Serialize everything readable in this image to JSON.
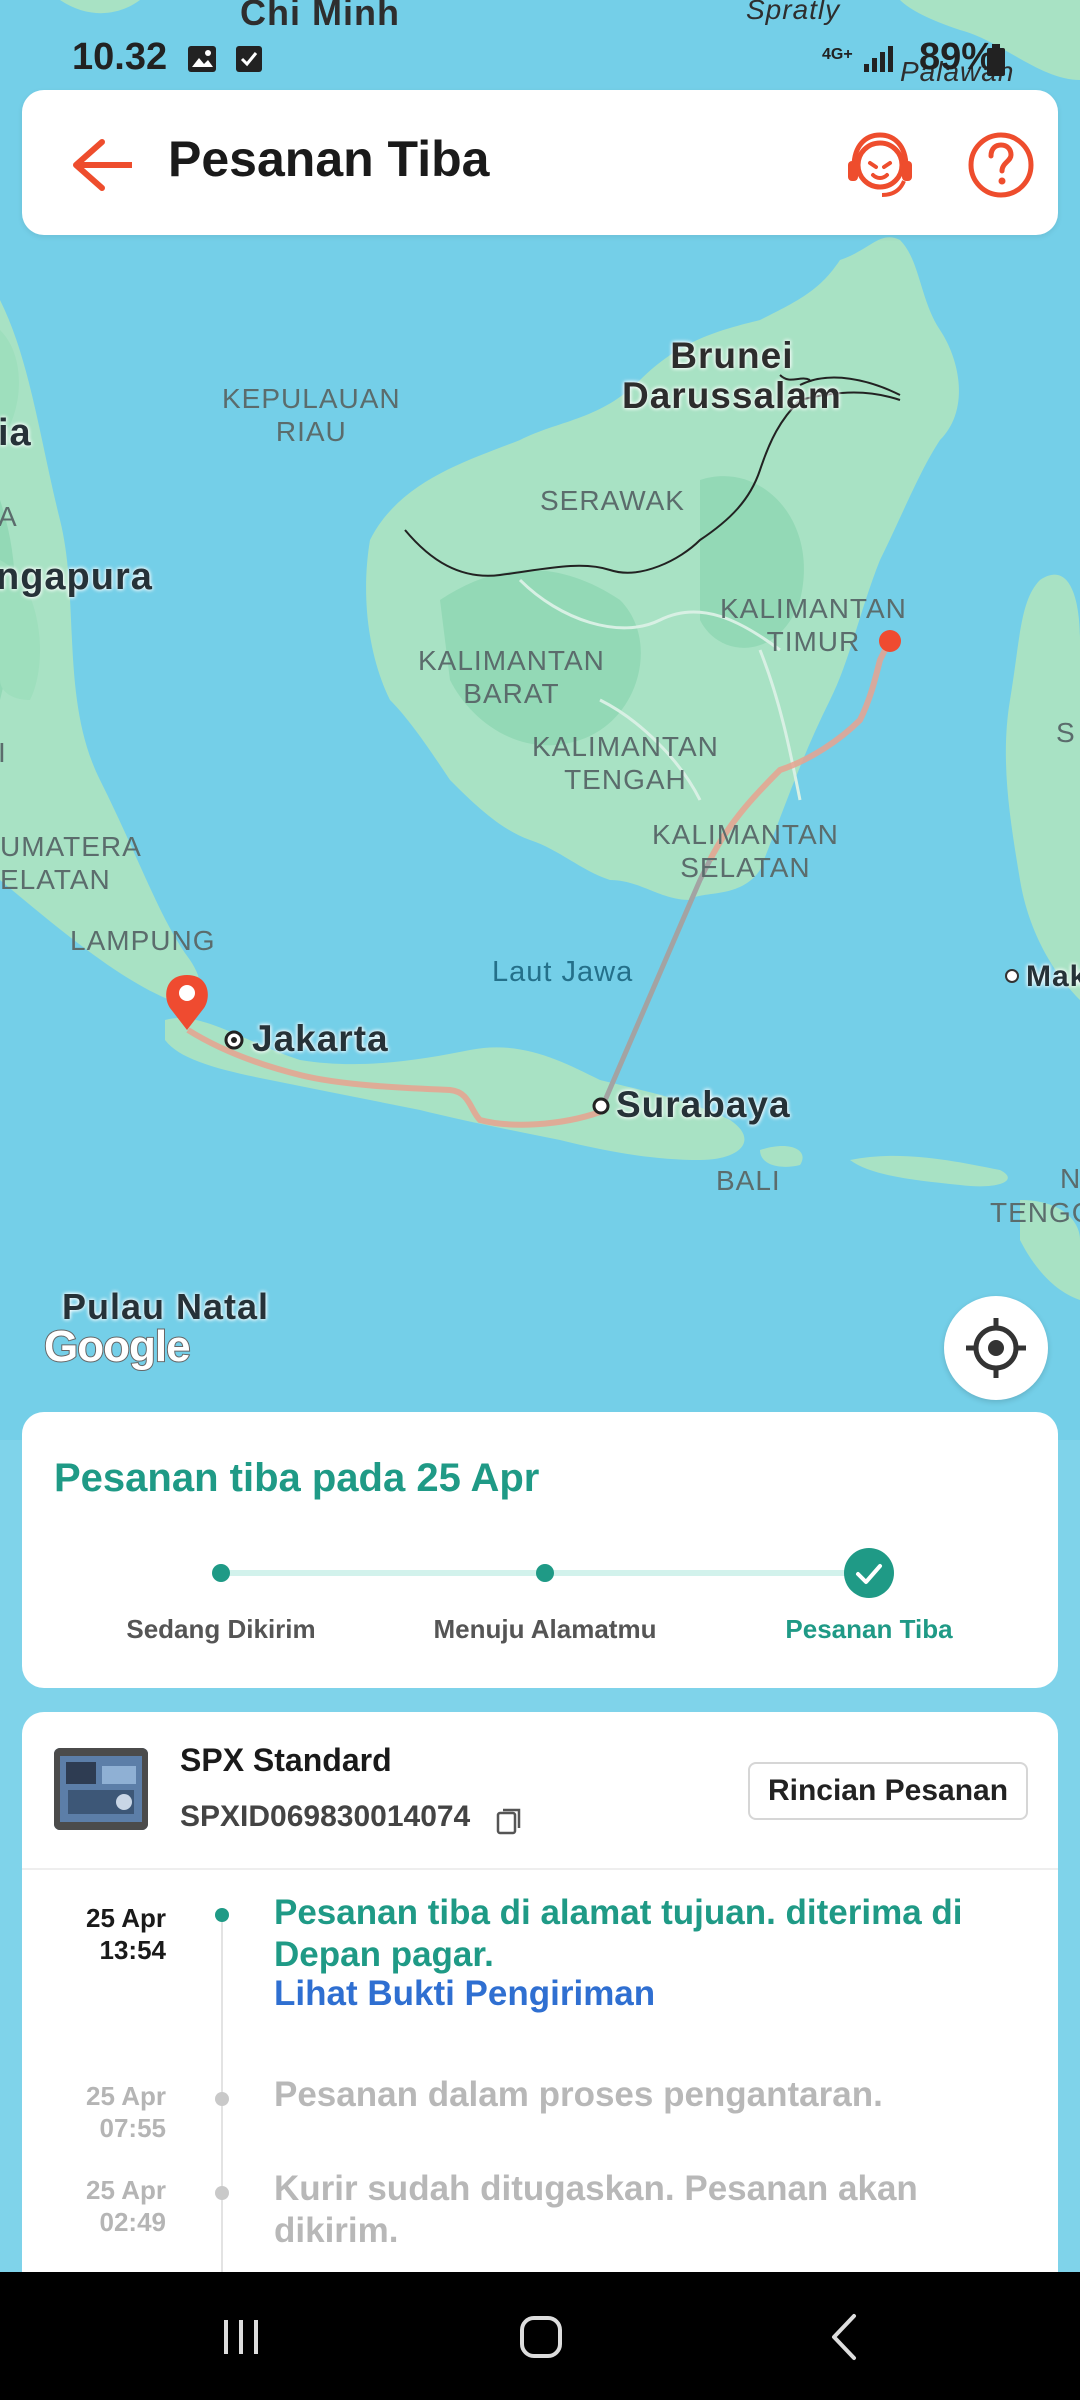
{
  "status_bar": {
    "time": "10.32",
    "network": "4G+",
    "battery": "89%"
  },
  "header": {
    "title": "Pesanan Tiba",
    "back_icon": "back-arrow-icon",
    "support_icon": "customer-support-icon",
    "help_icon": "help-icon"
  },
  "map": {
    "labels": {
      "chi_minh": "Chi Minh",
      "spratly": "Spratly",
      "palawan": "Palawan",
      "brunei": "Brunei\nDarussalam",
      "kepulauan_riau": "KEPULAUAN\nRIAU",
      "serawak": "SERAWAK",
      "kalimantan_timur": "KALIMANTAN\nTIMUR",
      "kalimantan_barat": "KALIMANTAN\nBARAT",
      "kalimantan_tengah": "KALIMANTAN\nTENGAH",
      "kalimantan_selatan": "KALIMANTAN\nSELATAN",
      "sumatera_selatan": "UMATERA\nELATAN",
      "lampung": "LAMPUNG",
      "laut_jawa": "Laut Jawa",
      "jakarta": "Jakarta",
      "surabaya": "Surabaya",
      "bali": "BALI",
      "singapura": "ngapura",
      "ia": "ia",
      "a": "A",
      "mak": "Mak",
      "tengg": "TENGG",
      "pulau_natal": "Pulau Natal",
      "s": "S",
      "n": "N",
      "i": "I"
    },
    "google_logo": "Google"
  },
  "status_card": {
    "title": "Pesanan tiba pada 25 Apr",
    "steps": [
      {
        "label": "Sedang Dikirim",
        "state": "done"
      },
      {
        "label": "Menuju Alamatmu",
        "state": "done"
      },
      {
        "label": "Pesanan Tiba",
        "state": "current"
      }
    ]
  },
  "shipment": {
    "courier": "SPX Standard",
    "tracking_number": "SPXID069830014074",
    "detail_button": "Rincian Pesanan",
    "events": [
      {
        "date": "25 Apr",
        "time": "13:54",
        "text": "Pesanan tiba di alamat tujuan. diterima di Depan pagar.",
        "link": "Lihat Bukti Pengiriman",
        "active": true
      },
      {
        "date": "25 Apr",
        "time": "07:55",
        "text": "Pesanan dalam proses pengantaran.",
        "active": false
      },
      {
        "date": "25 Apr",
        "time": "02:49",
        "text": "Kurir sudah ditugaskan. Pesanan akan dikirim.",
        "active": false
      }
    ]
  },
  "colors": {
    "accent": "#1f9a86",
    "brand_orange": "#ee4d2d",
    "link": "#2f6fd1"
  }
}
